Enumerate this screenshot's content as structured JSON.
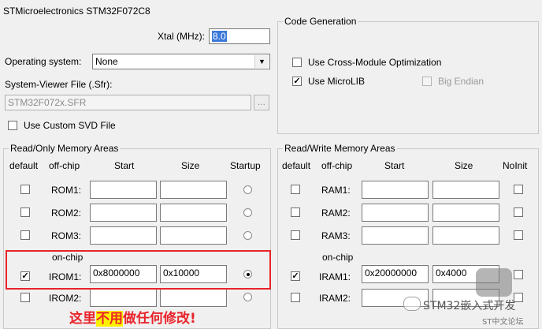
{
  "device": "STMicroelectronics STM32F072C8",
  "xtal": {
    "label": "Xtal (MHz):",
    "value": "8.0"
  },
  "os": {
    "label": "Operating system:",
    "value": "None"
  },
  "sfr": {
    "label": "System-Viewer File (.Sfr):",
    "value": "STM32F072x.SFR",
    "browse": "..."
  },
  "custom_svd": {
    "label": "Use Custom SVD File",
    "checked": false
  },
  "code_gen": {
    "title": "Code Generation",
    "cross_module": {
      "label": "Use Cross-Module Optimization",
      "checked": false
    },
    "microlib": {
      "label": "Use MicroLIB",
      "checked": true
    },
    "big_endian": {
      "label": "Big Endian",
      "checked": false
    }
  },
  "ro": {
    "title": "Read/Only Memory Areas",
    "headers": {
      "default": "default",
      "offchip": "off-chip",
      "start": "Start",
      "size": "Size",
      "startup": "Startup"
    },
    "onchip_label": "on-chip",
    "rows": [
      {
        "name": "ROM1:",
        "start": "",
        "size": "",
        "default": false,
        "startup": false
      },
      {
        "name": "ROM2:",
        "start": "",
        "size": "",
        "default": false,
        "startup": false
      },
      {
        "name": "ROM3:",
        "start": "",
        "size": "",
        "default": false,
        "startup": false
      },
      {
        "name": "IROM1:",
        "start": "0x8000000",
        "size": "0x10000",
        "default": true,
        "startup": true
      },
      {
        "name": "IROM2:",
        "start": "",
        "size": "",
        "default": false,
        "startup": false
      }
    ]
  },
  "rw": {
    "title": "Read/Write Memory Areas",
    "headers": {
      "default": "default",
      "offchip": "off-chip",
      "start": "Start",
      "size": "Size",
      "noinit": "NoInit"
    },
    "onchip_label": "on-chip",
    "rows": [
      {
        "name": "RAM1:",
        "start": "",
        "size": "",
        "default": false,
        "noinit": false
      },
      {
        "name": "RAM2:",
        "start": "",
        "size": "",
        "default": false,
        "noinit": false
      },
      {
        "name": "RAM3:",
        "start": "",
        "size": "",
        "default": false,
        "noinit": false
      },
      {
        "name": "IRAM1:",
        "start": "0x20000000",
        "size": "0x4000",
        "default": true,
        "noinit": false
      },
      {
        "name": "IRAM2:",
        "start": "",
        "size": "",
        "default": false,
        "noinit": false
      }
    ]
  },
  "annotation": {
    "before": "这里",
    "emph": "不用",
    "after": "做任何修改!"
  },
  "watermark": {
    "main": "STM32嵌入式开发",
    "sub": "ST中文论坛"
  },
  "colors": {
    "highlight": "#e8232a",
    "focus_selection": "#3a78d8"
  }
}
